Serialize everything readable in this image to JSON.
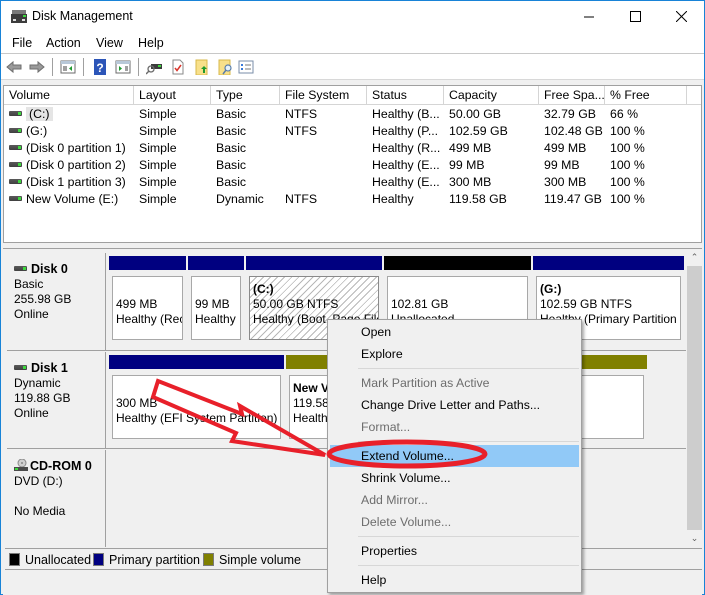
{
  "window": {
    "title": "Disk Management",
    "controls": {
      "minimize": "minimize",
      "maximize": "maximize",
      "close": "close"
    }
  },
  "menubar": {
    "items": [
      {
        "label": "File"
      },
      {
        "label": "Action"
      },
      {
        "label": "View"
      },
      {
        "label": "Help"
      }
    ]
  },
  "toolbar": {
    "buttons": [
      {
        "icon": "back-arrow-icon"
      },
      {
        "icon": "forward-arrow-icon"
      },
      {
        "icon": "show-hide-console-tree-icon"
      },
      {
        "icon": "help-icon"
      },
      {
        "icon": "show-hide-action-pane-icon"
      },
      {
        "icon": "connect-drive-icon"
      },
      {
        "icon": "check-document-icon"
      },
      {
        "icon": "folder-up-icon"
      },
      {
        "icon": "folder-search-icon"
      },
      {
        "icon": "properties-list-icon"
      }
    ]
  },
  "volume_list": {
    "columns": [
      "Volume",
      "Layout",
      "Type",
      "File System",
      "Status",
      "Capacity",
      "Free Spa...",
      "% Free"
    ],
    "rows": [
      {
        "volume": "(C:)",
        "layout": "Simple",
        "type": "Basic",
        "fs": "NTFS",
        "status": "Healthy (B...",
        "capacity": "50.00 GB",
        "free": "32.79 GB",
        "pct": "66 %"
      },
      {
        "volume": "(G:)",
        "layout": "Simple",
        "type": "Basic",
        "fs": "NTFS",
        "status": "Healthy (P...",
        "capacity": "102.59 GB",
        "free": "102.48 GB",
        "pct": "100 %"
      },
      {
        "volume": "(Disk 0 partition 1)",
        "layout": "Simple",
        "type": "Basic",
        "fs": "",
        "status": "Healthy (R...",
        "capacity": "499 MB",
        "free": "499 MB",
        "pct": "100 %"
      },
      {
        "volume": "(Disk 0 partition 2)",
        "layout": "Simple",
        "type": "Basic",
        "fs": "",
        "status": "Healthy (E...",
        "capacity": "99 MB",
        "free": "99 MB",
        "pct": "100 %"
      },
      {
        "volume": "(Disk 1 partition 3)",
        "layout": "Simple",
        "type": "Basic",
        "fs": "",
        "status": "Healthy (E...",
        "capacity": "300 MB",
        "free": "300 MB",
        "pct": "100 %"
      },
      {
        "volume": "New Volume (E:)",
        "layout": "Simple",
        "type": "Dynamic",
        "fs": "NTFS",
        "status": "Healthy",
        "capacity": "119.58 GB",
        "free": "119.47 GB",
        "pct": "100 %"
      }
    ]
  },
  "disks": [
    {
      "name": "Disk 0",
      "kind": "Basic",
      "size": "255.98 GB",
      "state": "Online",
      "partitions": [
        {
          "title": "",
          "line1": "499 MB",
          "line2": "Healthy (Rec",
          "color": "#000080"
        },
        {
          "title": "",
          "line1": "99 MB",
          "line2": "Healthy",
          "color": "#000080"
        },
        {
          "title": "(C:)",
          "line1": "50.00 GB NTFS",
          "line2": "Healthy (Boot, Page File",
          "color": "#000080"
        },
        {
          "title": "",
          "line1": "102.81 GB",
          "line2": "Unallocated",
          "color": "#000000"
        },
        {
          "title": "(G:)",
          "line1": "102.59 GB NTFS",
          "line2": "Healthy (Primary Partition",
          "color": "#000080"
        }
      ]
    },
    {
      "name": "Disk 1",
      "kind": "Dynamic",
      "size": "119.88 GB",
      "state": "Online",
      "partitions": [
        {
          "title": "",
          "line1": "300 MB",
          "line2": "Healthy (EFI System Partition)",
          "color": "#000080"
        },
        {
          "title": "New Volume (E:)",
          "line1": "119.58 GB NTFS",
          "line2": "Healthy",
          "color": "#808000"
        }
      ]
    },
    {
      "name": "CD-ROM 0",
      "kind": "DVD (D:)",
      "size": "",
      "state": "No Media",
      "partitions": []
    }
  ],
  "legend": [
    {
      "label": "Unallocated",
      "color": "#000000"
    },
    {
      "label": "Primary partition",
      "color": "#000080"
    },
    {
      "label": "Simple volume",
      "color": "#808000"
    }
  ],
  "context_menu": {
    "items": [
      {
        "label": "Open",
        "enabled": true
      },
      {
        "label": "Explore",
        "enabled": true
      },
      {
        "separator": true
      },
      {
        "label": "Mark Partition as Active",
        "enabled": false
      },
      {
        "label": "Change Drive Letter and Paths...",
        "enabled": true
      },
      {
        "label": "Format...",
        "enabled": false
      },
      {
        "separator": true
      },
      {
        "label": "Extend Volume...",
        "enabled": true,
        "highlighted": true
      },
      {
        "label": "Shrink Volume...",
        "enabled": true
      },
      {
        "label": "Add Mirror...",
        "enabled": false
      },
      {
        "label": "Delete Volume...",
        "enabled": false
      },
      {
        "separator": true
      },
      {
        "label": "Properties",
        "enabled": true
      },
      {
        "separator": true
      },
      {
        "label": "Help",
        "enabled": true
      }
    ]
  },
  "annotation": {
    "arrow_color": "#e8202a",
    "highlight_target": "Extend Volume..."
  }
}
